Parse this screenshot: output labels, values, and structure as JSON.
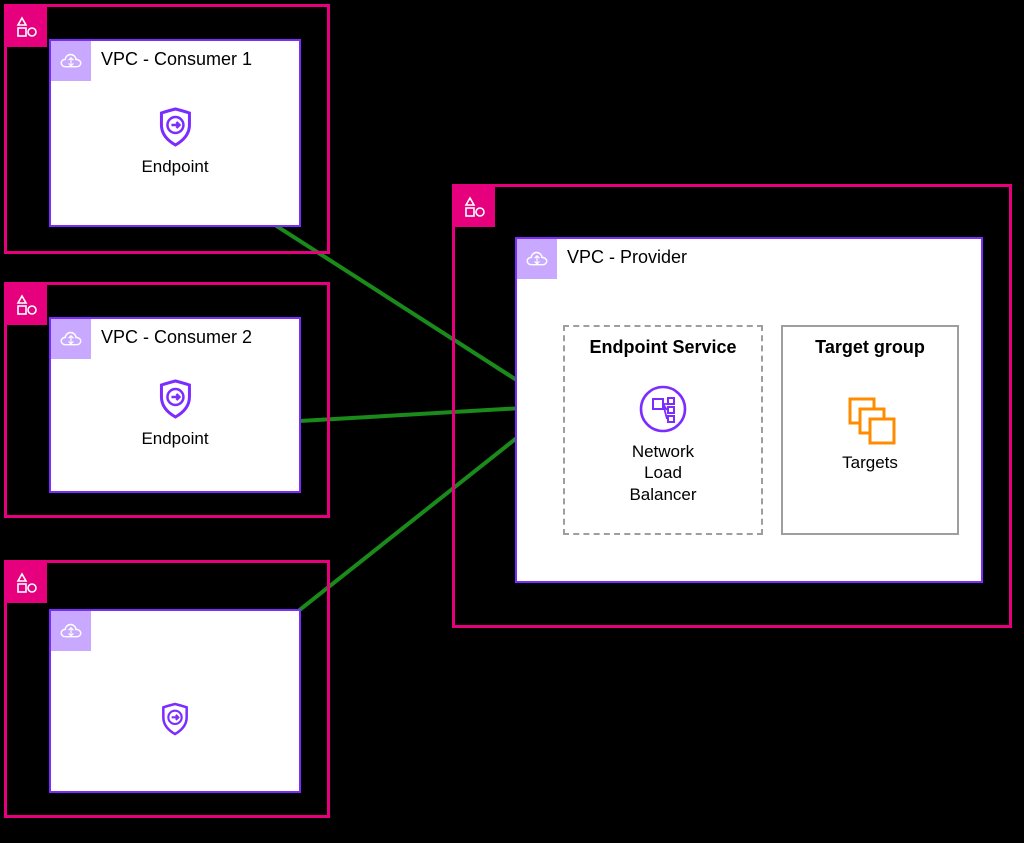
{
  "consumers": [
    {
      "vpc_title": "VPC - Consumer 1",
      "endpoint_label": "Endpoint"
    },
    {
      "vpc_title": "VPC - Consumer 2",
      "endpoint_label": "Endpoint"
    },
    {
      "vpc_title": "",
      "endpoint_label": ""
    }
  ],
  "provider": {
    "vpc_title": "VPC - Provider",
    "endpoint_service_title": "Endpoint Service",
    "nlb_label": "Network Load Balancer",
    "target_group_title": "Target group",
    "targets_label": "Targets"
  },
  "colors": {
    "region_border": "#e6007e",
    "vpc_border": "#7b2cff",
    "vpc_tag_bg": "#c9a9ff",
    "connection_line": "#1a8a1a",
    "target_arrow": "#ff8c00",
    "dashed_border": "#9e9e9e"
  }
}
